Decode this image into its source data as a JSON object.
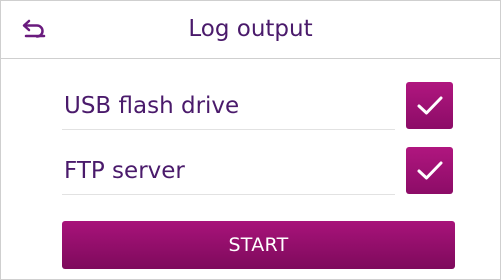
{
  "header": {
    "title": "Log output",
    "back_icon": "back-arrow-icon"
  },
  "options": [
    {
      "label": "USB flash drive",
      "checked": true,
      "icon": "checkmark-icon"
    },
    {
      "label": "FTP server",
      "checked": true,
      "icon": "checkmark-icon"
    }
  ],
  "actions": {
    "start_label": "START"
  },
  "colors": {
    "accent": "#9b1173",
    "text": "#4a1a6b",
    "divider": "#cfcfcf"
  }
}
